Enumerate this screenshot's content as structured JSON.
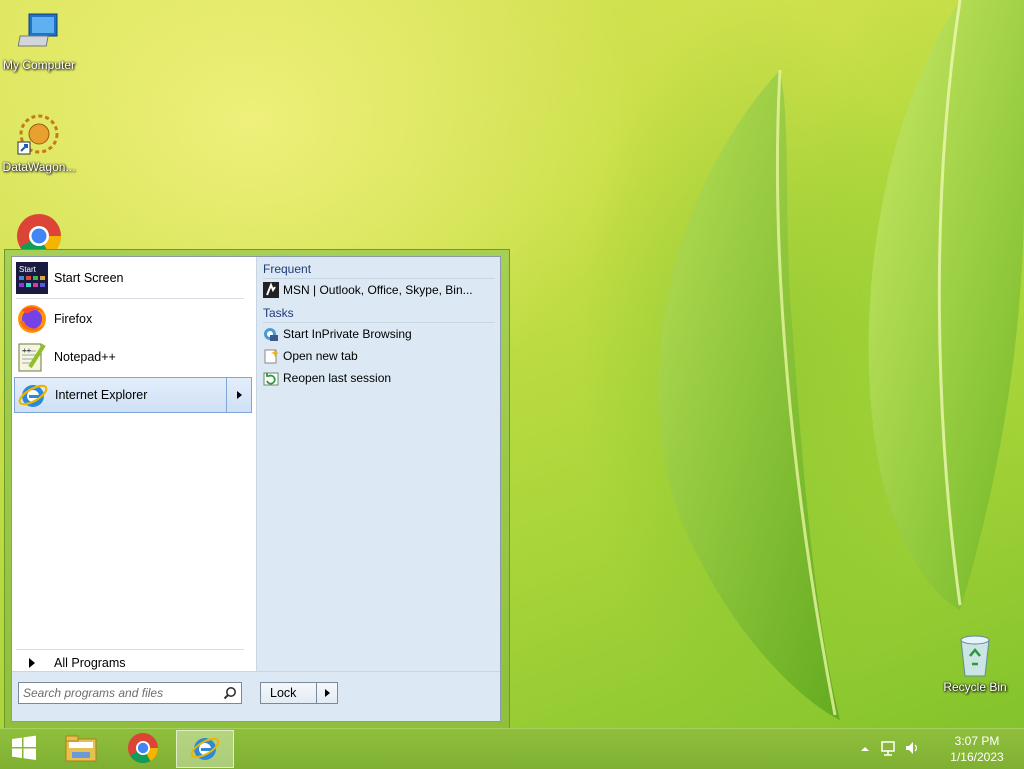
{
  "desktop": {
    "icons": [
      {
        "label": "My Computer"
      },
      {
        "label": "DataWagon..."
      },
      {
        "label": "Recycle Bin"
      }
    ]
  },
  "start_menu": {
    "pinned": [
      {
        "label": "Start Screen",
        "icon": "start-screen-icon"
      },
      {
        "label": "Firefox",
        "icon": "firefox-icon"
      },
      {
        "label": "Notepad++",
        "icon": "notepad-plus-plus-icon"
      },
      {
        "label": "Internet Explorer",
        "icon": "internet-explorer-icon",
        "selected": true
      }
    ],
    "all_programs": "All Programs",
    "jumplist": {
      "frequent_header": "Frequent",
      "frequent": [
        {
          "label": "MSN | Outlook, Office, Skype, Bin...",
          "icon": "msn-icon"
        }
      ],
      "tasks_header": "Tasks",
      "tasks": [
        {
          "label": "Start InPrivate Browsing",
          "icon": "inprivate-icon"
        },
        {
          "label": "Open new tab",
          "icon": "new-tab-icon"
        },
        {
          "label": "Reopen last session",
          "icon": "reopen-session-icon"
        }
      ]
    },
    "search": {
      "placeholder": "Search programs and files",
      "value": ""
    },
    "lock_label": "Lock"
  },
  "taskbar": {
    "apps": [
      {
        "name": "start-button"
      },
      {
        "name": "file-explorer"
      },
      {
        "name": "chrome"
      },
      {
        "name": "internet-explorer",
        "active": true
      }
    ],
    "clock": {
      "time": "3:07 PM",
      "date": "1/16/2023"
    }
  },
  "colors": {
    "taskbar": "#7fb032",
    "start_border": "#8fbf3d",
    "right_pane": "#dce9f5",
    "selection": "#cfe0f5"
  }
}
